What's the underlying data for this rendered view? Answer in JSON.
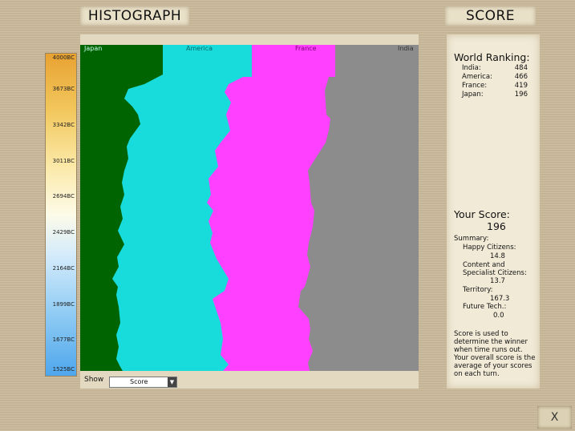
{
  "header": {
    "histograph_title": "HISTOGRAPH",
    "score_title": "SCORE"
  },
  "timeline": {
    "ticks": [
      "4000BC",
      "3673BC",
      "3342BC",
      "3011BC",
      "2694BC",
      "2429BC",
      "2164BC",
      "1899BC",
      "1677BC",
      "1525BC"
    ]
  },
  "legend": [
    {
      "label": "Japan",
      "color": "#006400"
    },
    {
      "label": "America",
      "color": "#18dcdc"
    },
    {
      "label": "France",
      "color": "#ff40ff"
    },
    {
      "label": "India",
      "color": "#8c8c8c"
    }
  ],
  "controls": {
    "show_label": "Show",
    "show_value": "Score"
  },
  "world_ranking": {
    "title": "World Ranking:",
    "rows": [
      {
        "name": "India:",
        "score": "484"
      },
      {
        "name": "America:",
        "score": "466"
      },
      {
        "name": "France:",
        "score": "419"
      },
      {
        "name": "Japan:",
        "score": "196"
      }
    ]
  },
  "your_score": {
    "title": "Your Score:",
    "value": "196",
    "summary_label": "Summary:",
    "happy_label": "Happy Citizens:",
    "happy_value": "14.8",
    "content_label_1": "Content and",
    "content_label_2": "Specialist Citizens:",
    "content_value": "13.7",
    "territory_label": "Territory:",
    "territory_value": "167.3",
    "future_label": "Future Tech.:",
    "future_value": "0.0",
    "note_1": "Score is used to",
    "note_2": "determine the winner",
    "note_3": "when time runs out.",
    "note_4": "Your overall score is the",
    "note_5": "average of your scores",
    "note_6": "on each turn."
  },
  "close_label": "X"
}
